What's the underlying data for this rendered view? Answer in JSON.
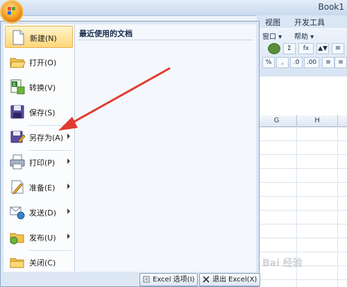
{
  "window": {
    "title": "Book1"
  },
  "ribbon": {
    "tabs": [
      "视图",
      "开发工具"
    ],
    "row1": [
      "窗口 ▾",
      "帮助 ▾"
    ],
    "row2_buttons": [
      "Σ",
      "fx",
      "▲▼"
    ],
    "row3_buttons": [
      "%",
      ",",
      ".0",
      ".00"
    ]
  },
  "sheet": {
    "columns": [
      "G",
      "H"
    ]
  },
  "menu": {
    "recent_title": "最近使用的文档",
    "items": [
      {
        "label": "新建(N)",
        "icon": "new-document-icon",
        "submenu": false,
        "highlighted": true
      },
      {
        "label": "打开(O)",
        "icon": "open-folder-icon",
        "submenu": false
      },
      {
        "label": "转换(V)",
        "icon": "convert-icon",
        "submenu": false
      },
      {
        "label": "保存(S)",
        "icon": "save-icon",
        "submenu": false
      },
      {
        "label": "另存为(A)",
        "icon": "save-as-icon",
        "submenu": true
      },
      {
        "label": "打印(P)",
        "icon": "print-icon",
        "submenu": true
      },
      {
        "label": "准备(E)",
        "icon": "prepare-icon",
        "submenu": true
      },
      {
        "label": "发送(D)",
        "icon": "send-icon",
        "submenu": true
      },
      {
        "label": "发布(U)",
        "icon": "publish-icon",
        "submenu": true
      },
      {
        "label": "关闭(C)",
        "icon": "close-folder-icon",
        "submenu": false
      }
    ],
    "options_button": "Excel 选项(I)",
    "exit_button": "退出 Excel(X)"
  },
  "watermark": "Bai 经验",
  "colors": {
    "annotation_arrow": "#e23a2f",
    "highlight": "#ffd77a",
    "office_button": "#f39a1d"
  }
}
